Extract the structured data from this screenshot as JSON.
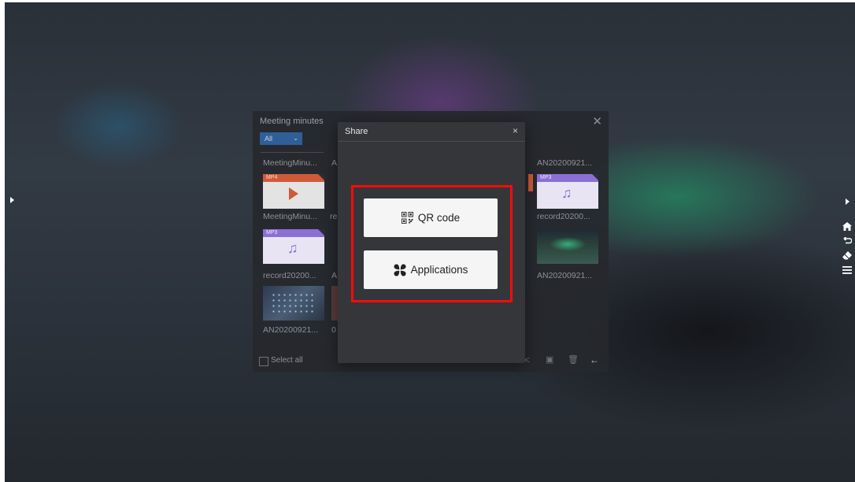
{
  "background_panel": {
    "title": "Meeting minutes",
    "filter": {
      "selected": "All"
    },
    "tiles": [
      {
        "name": "MeetingMinu...",
        "type": "MP4"
      },
      {
        "name": "A",
        "type": ""
      },
      {
        "name": "AN20200921...",
        "type": "MP3"
      },
      {
        "name": "MeetingMinu...",
        "type": "MP3"
      },
      {
        "name": "re",
        "type": ""
      },
      {
        "name": "record20200...",
        "type": "screenshot"
      },
      {
        "name": "record20200...",
        "type": "screenshot"
      },
      {
        "name": "A",
        "type": ""
      },
      {
        "name": "AN20200921...",
        "type": ""
      },
      {
        "name": "AN20200921...",
        "type": ""
      },
      {
        "name": "0",
        "type": ""
      }
    ],
    "select_all_label": "Select all"
  },
  "share_dialog": {
    "title": "Share",
    "close_glyph": "×",
    "options": [
      {
        "label": "QR code",
        "icon": "qr-code-icon"
      },
      {
        "label": "Applications",
        "icon": "applications-icon"
      }
    ],
    "highlight_color": "#ff0a0a"
  },
  "right_toolbar": {
    "icons": [
      "chevron-right-icon",
      "home-icon",
      "back-icon",
      "eraser-icon",
      "menu-icon"
    ]
  }
}
